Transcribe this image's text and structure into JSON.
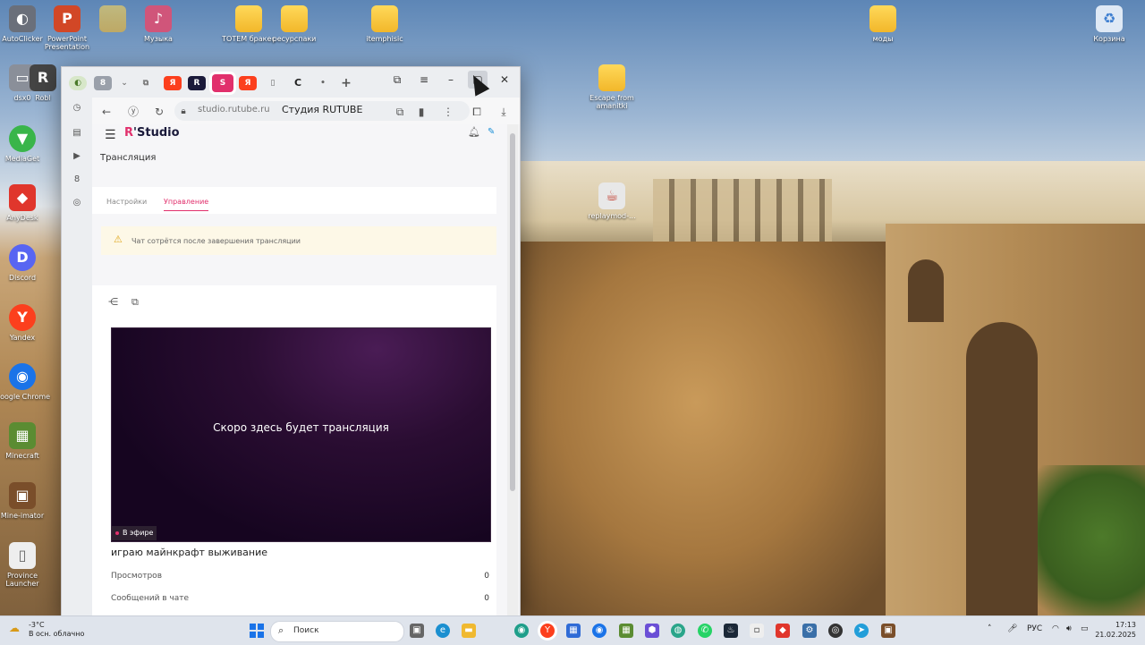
{
  "desktop": {
    "icons": [
      {
        "label": "AutoClicker",
        "glyph": "◐",
        "color": "#6a6f7a"
      },
      {
        "label": "PowerPoint Presentation",
        "glyph": "P",
        "color": "#d24726"
      },
      {
        "label": "",
        "glyph": "",
        "color": "#f2c94c"
      },
      {
        "label": "Музыка",
        "glyph": "♪",
        "color": "#d0557a"
      },
      {
        "label": "ТОТЕМ бракес",
        "glyph": "",
        "color": "#f2c94c"
      },
      {
        "label": "ресурспаки",
        "glyph": "",
        "color": "#f2c94c"
      },
      {
        "label": "itemphisic",
        "glyph": "",
        "color": "#f2c94c"
      },
      {
        "label": "моды",
        "glyph": "",
        "color": "#f2c94c"
      },
      {
        "label": "Корзина",
        "glyph": "♻",
        "color": "#3f7fd0"
      },
      {
        "label": "dsx0",
        "glyph": "▭",
        "color": "#8a8f99"
      },
      {
        "label": "Robl",
        "glyph": "R",
        "color": "#444"
      },
      {
        "label": "MediaGet",
        "glyph": "▼",
        "color": "#39b54a"
      },
      {
        "label": "AnyDesk",
        "glyph": "◆",
        "color": "#e0362c"
      },
      {
        "label": "Discord",
        "glyph": "D",
        "color": "#5865f2"
      },
      {
        "label": "Yandex",
        "glyph": "Y",
        "color": "#fc3f1d"
      },
      {
        "label": "Google Chrome",
        "glyph": "◉",
        "color": "#1a73e8"
      },
      {
        "label": "Minecraft",
        "glyph": "▦",
        "color": "#5b8c32"
      },
      {
        "label": "Mine-imator",
        "glyph": "▣",
        "color": "#7a4e2a"
      },
      {
        "label": "Province Launcher",
        "glyph": "▯",
        "color": "#eeeeee"
      },
      {
        "label": "Escape from amanitki",
        "glyph": "",
        "color": "#f2c94c"
      },
      {
        "label": "replaymod-...",
        "glyph": "☕",
        "color": "#e8e8e8"
      }
    ]
  },
  "browser": {
    "url": "studio.rutube.ru",
    "page_title": "Студия RUTUBE",
    "tabs": [
      {
        "glyph": "◐",
        "color": "#d7e7c9"
      },
      {
        "glyph": "8",
        "color": "#9aa0aa"
      },
      {
        "glyph": "Я",
        "color": "#fc3f1d"
      },
      {
        "glyph": "R",
        "color": "#1a1a3a"
      },
      {
        "glyph": "S",
        "color": "#e1306c"
      },
      {
        "glyph": "Я",
        "color": "#fc3f1d"
      },
      {
        "glyph": "▯",
        "color": "#9aa0aa"
      },
      {
        "glyph": "C",
        "color": "#222"
      }
    ],
    "new_tab": "+"
  },
  "studio": {
    "logo": {
      "prefix": "R",
      "name": "Studio"
    },
    "page_heading": "Трансляция",
    "tabs": {
      "settings": "Настройки",
      "manage": "Управление"
    },
    "alert": "Чат сотрётся после завершения трансляции",
    "player": {
      "placeholder": "Скоро здесь будет трансляция",
      "badge": "В эфире"
    },
    "stream_title": "играю майнкрафт выживание",
    "stats": [
      {
        "label": "Просмотров",
        "value": "0"
      },
      {
        "label": "Сообщений в чате",
        "value": "0"
      }
    ]
  },
  "taskbar": {
    "weather_temp": "-3°C",
    "weather_desc": "В осн. облачно",
    "search_label": "Поиск",
    "language": "РУС",
    "time": "17:13",
    "date": "21.02.2025"
  }
}
